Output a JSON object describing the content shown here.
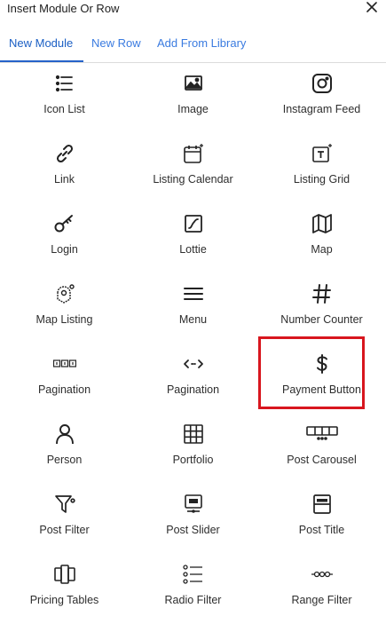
{
  "header": {
    "title": "Insert Module Or Row",
    "close_icon": "close-icon"
  },
  "tabs": [
    {
      "label": "New Module",
      "active": true
    },
    {
      "label": "New Row",
      "active": false
    },
    {
      "label": "Add From Library",
      "active": false
    }
  ],
  "accent_color": "#2563c9",
  "highlight_color": "#d8161e",
  "modules": [
    {
      "label": "Icon List",
      "icon": "icon-list-icon"
    },
    {
      "label": "Image",
      "icon": "image-icon"
    },
    {
      "label": "Instagram Feed",
      "icon": "instagram-icon"
    },
    {
      "label": "Link",
      "icon": "link-icon"
    },
    {
      "label": "Listing Calendar",
      "icon": "calendar-icon"
    },
    {
      "label": "Listing Grid",
      "icon": "grid-text-icon"
    },
    {
      "label": "Login",
      "icon": "key-icon"
    },
    {
      "label": "Lottie",
      "icon": "lottie-icon"
    },
    {
      "label": "Map",
      "icon": "map-icon"
    },
    {
      "label": "Map Listing",
      "icon": "map-pin-icon"
    },
    {
      "label": "Menu",
      "icon": "menu-icon"
    },
    {
      "label": "Number Counter",
      "icon": "hash-icon"
    },
    {
      "label": "Pagination",
      "icon": "pagination-numbers-icon"
    },
    {
      "label": "Pagination",
      "icon": "pagination-arrows-icon"
    },
    {
      "label": "Payment Button",
      "icon": "dollar-icon",
      "highlighted": true
    },
    {
      "label": "Person",
      "icon": "person-icon"
    },
    {
      "label": "Portfolio",
      "icon": "portfolio-grid-icon"
    },
    {
      "label": "Post Carousel",
      "icon": "carousel-icon"
    },
    {
      "label": "Post Filter",
      "icon": "filter-icon"
    },
    {
      "label": "Post Slider",
      "icon": "slider-icon"
    },
    {
      "label": "Post Title",
      "icon": "post-title-icon"
    },
    {
      "label": "Pricing Tables",
      "icon": "pricing-tables-icon"
    },
    {
      "label": "Radio Filter",
      "icon": "radio-filter-icon"
    },
    {
      "label": "Range Filter",
      "icon": "range-filter-icon"
    }
  ]
}
